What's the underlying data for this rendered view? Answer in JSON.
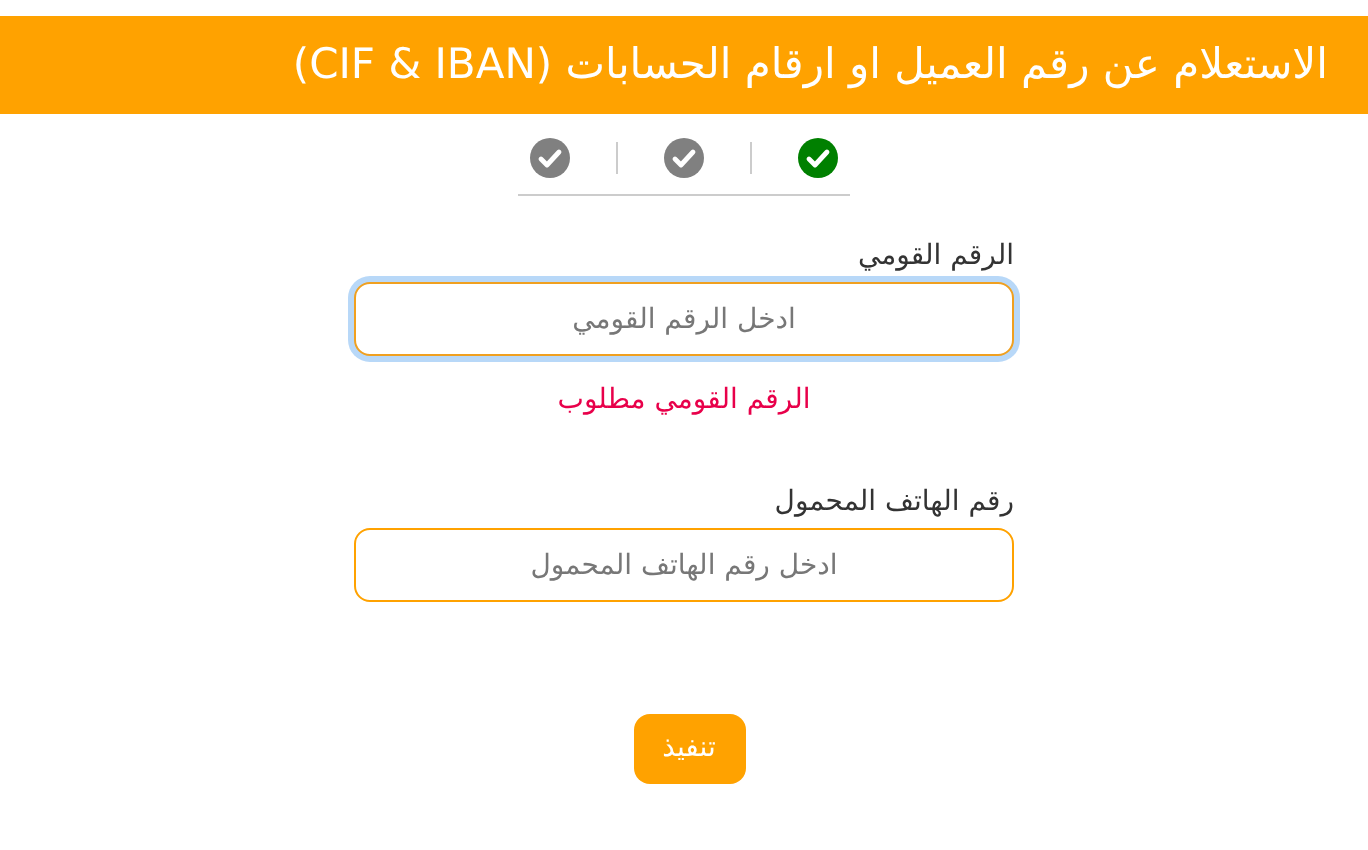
{
  "header": {
    "title": "الاستعلام عن رقم العميل او ارقام الحسابات (CIF & IBAN)"
  },
  "steps": [
    {
      "selected": true
    },
    {
      "selected": false
    },
    {
      "selected": false
    }
  ],
  "fields": [
    {
      "label": "الرقم القومي",
      "placeholder": "ادخل الرقم القومي",
      "focused": true,
      "error": "الرقم القومي مطلوب"
    },
    {
      "label": "رقم الهاتف المحمول",
      "placeholder": "ادخل رقم الهاتف المحمول",
      "focused": false
    }
  ],
  "submit_button": "تنفيذ"
}
